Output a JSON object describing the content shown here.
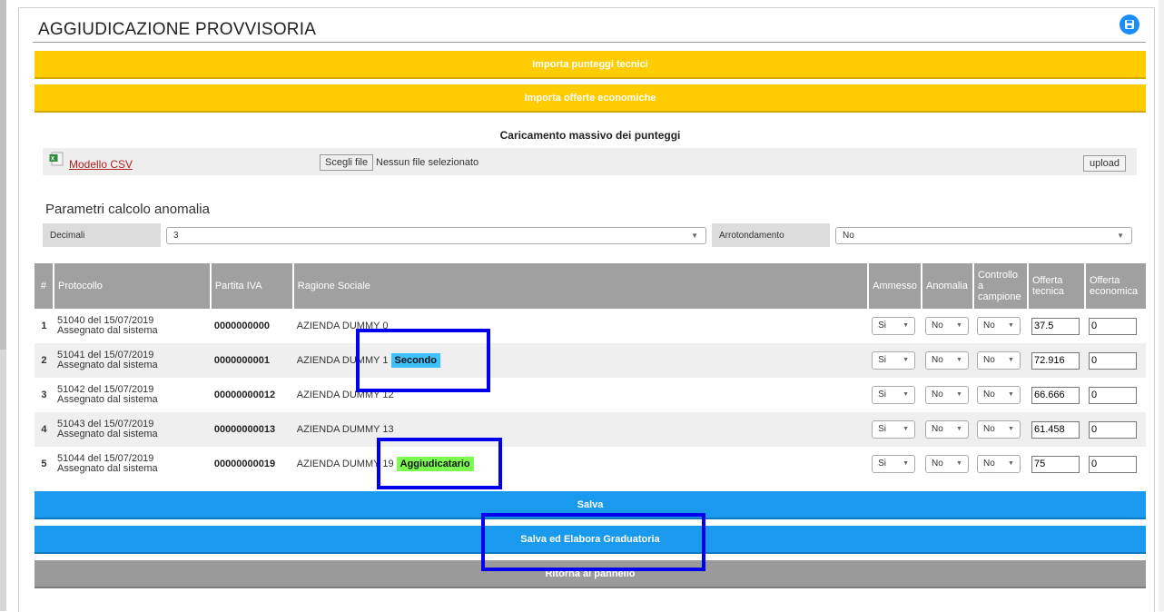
{
  "page": {
    "title": "AGGIUDICAZIONE PROVVISORIA",
    "save_icon": "floppy-disk-icon"
  },
  "actions": {
    "import_tech": "Importa punteggi tecnici",
    "import_econ": "Importa offerte economiche",
    "save": "Salva",
    "save_rank": "Salva ed Elabora Graduatoria",
    "back": "Ritorna al pannello"
  },
  "csv": {
    "title": "Caricamento massivo dei punteggi",
    "model_link": "Modello CSV",
    "choose_file": "Scegli file",
    "no_file": "Nessun file selezionato",
    "upload": "upload"
  },
  "params": {
    "title": "Parametri calcolo anomalia",
    "decimals_label": "Decimali",
    "decimals_value": "3",
    "rounding_label": "Arrotondamento",
    "rounding_value": "No"
  },
  "table": {
    "headers": {
      "num": "#",
      "protocol": "Protocollo",
      "vat": "Partita IVA",
      "company": "Ragione Sociale",
      "admitted": "Ammesso",
      "anomaly": "Anomalia",
      "check": "Controllo a campione",
      "tech": "Offerta tecnica",
      "econ": "Offerta economica"
    },
    "rows": [
      {
        "num": "1",
        "protocol": "51040 del 15/07/2019",
        "assigned": "Assegnato dal sistema",
        "vat": "0000000000",
        "company": "AZIENDA DUMMY 0",
        "badge": "",
        "admitted": "Si",
        "anomaly": "No",
        "check": "No",
        "tech": "37.5",
        "econ": "0"
      },
      {
        "num": "2",
        "protocol": "51041 del 15/07/2019",
        "assigned": "Assegnato dal sistema",
        "vat": "0000000001",
        "company": "AZIENDA DUMMY 1",
        "badge": "Secondo",
        "admitted": "Si",
        "anomaly": "No",
        "check": "No",
        "tech": "72.916",
        "econ": "0"
      },
      {
        "num": "3",
        "protocol": "51042 del 15/07/2019",
        "assigned": "Assegnato dal sistema",
        "vat": "00000000012",
        "company": "AZIENDA DUMMY 12",
        "badge": "",
        "admitted": "Si",
        "anomaly": "No",
        "check": "No",
        "tech": "66.666",
        "econ": "0"
      },
      {
        "num": "4",
        "protocol": "51043 del 15/07/2019",
        "assigned": "Assegnato dal sistema",
        "vat": "00000000013",
        "company": "AZIENDA DUMMY 13",
        "badge": "",
        "admitted": "Si",
        "anomaly": "No",
        "check": "No",
        "tech": "61.458",
        "econ": "0"
      },
      {
        "num": "5",
        "protocol": "51044 del 15/07/2019",
        "assigned": "Assegnato dal sistema",
        "vat": "00000000019",
        "company": "AZIENDA DUMMY 19",
        "badge": "Aggiudicatario",
        "admitted": "Si",
        "anomaly": "No",
        "check": "No",
        "tech": "75",
        "econ": "0"
      }
    ]
  },
  "colors": {
    "yellow_bar": "#ffcc00",
    "blue_bar": "#1a9aef",
    "gray_bar": "#9a9a9a",
    "badge_second": "#3ec1ff",
    "badge_winner": "#7cfc50",
    "highlight_box": "#0000ee"
  }
}
